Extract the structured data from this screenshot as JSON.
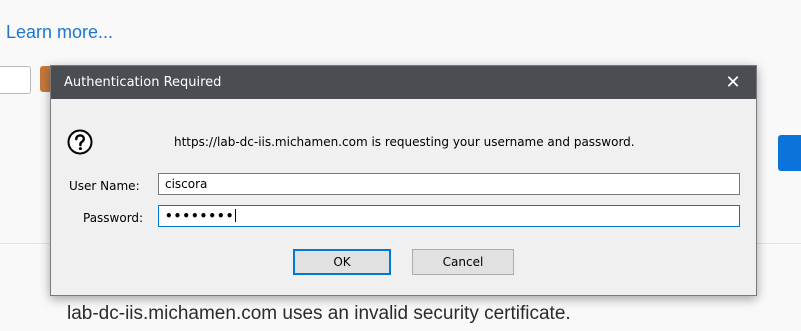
{
  "background": {
    "learn_more_link": "Learn more...",
    "certificate_message": "lab-dc-iis.michamen.com uses an invalid security certificate."
  },
  "dialog": {
    "title": "Authentication Required",
    "close_icon": "✕",
    "message": "https://lab-dc-iis.michamen.com is requesting your username and password.",
    "username_label": "User Name:",
    "username_value": "ciscora",
    "password_label": "Password:",
    "password_value": "••••••••",
    "ok_label": "OK",
    "cancel_label": "Cancel"
  },
  "colors": {
    "titlebar": "#4a4e53",
    "link": "#1b75d1",
    "focus_border": "#0078d7"
  },
  "icons": {
    "question": "question-icon",
    "close": "close-icon"
  }
}
